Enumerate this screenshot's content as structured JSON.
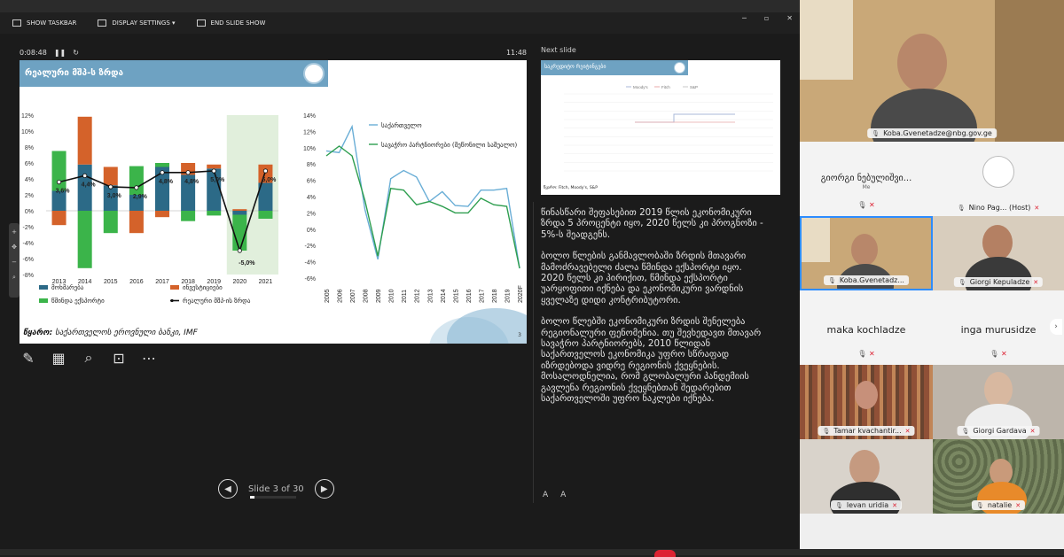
{
  "toolbar": {
    "show_taskbar": "SHOW TASKBAR",
    "display_settings": "DISPLAY SETTINGS ▾",
    "end_slide_show": "END SLIDE SHOW"
  },
  "timer": {
    "elapsed": "0:08:48",
    "clock": "11:48"
  },
  "next_slide_label": "Next slide",
  "slide": {
    "title": "რეალური მშპ-ს ზრდა",
    "source_label": "წყარო:",
    "source_text": " საქართველოს ეროვნული ბანკი, IMF",
    "page": "3"
  },
  "navigation": {
    "slide_counter": "Slide 3 of 30",
    "progress": 0.1
  },
  "next_slide": {
    "title": "საკრედიტო რეიტინგები",
    "legend": [
      "Moody's",
      "Fitch",
      "S&P"
    ],
    "source": "წყარო: Fitch, Moody's, S&P"
  },
  "notes": [
    "წინასწარი შეფასებით 2019 წლის ეკონომიკური ზრდა 5 პროცენტი იყო, 2020 წელს კი პროგნოზი - 5%-ს შეადგენს.",
    "ბოლო წლების განმავლობაში ზრდის მთავარი მამოძრავებელი ძალა წმინდა ექსპორტი იყო. 2020 წელს კი პირიქით, წმინდა ექსპორტი უარყოფითი იქნება და ეკონომიკური ვარდნის ყველაზე დიდი კონტრიბუტორი.",
    "ბოლო წლებში ეკონომიკური ზრდის შენელება რეგიონალური ფენომენია. თუ შევხედავთ მთავარ სავაჭრო პარტნიორებს, 2010 წლიდან საქართველოს ეკონომიკა უფრო სწრაფად იზრდებოდა ვიდრე რეგიონის ქვეყნების. მოსალოდნელია, რომ გლობალური პანდემიის გავლენა რეგიონის ქვეყნებთან შედარებით საქართველოში უფრო ნაკლები იქნება."
  ],
  "font_buttons": [
    "A",
    "A"
  ],
  "participants": [
    {
      "name": "Koba.Gvenetadze@nbg.gov.ge",
      "muted": false
    },
    {
      "name": "გიორგი ნებულიშვი...",
      "sub": "Me",
      "muted": true
    },
    {
      "name": "Nino Pag... (Host)",
      "muted": true
    },
    {
      "name": "Koba.Gvenetadz...",
      "muted": false
    },
    {
      "name": "Giorgi Kepuladze",
      "muted": true
    },
    {
      "name": "maka kochladze",
      "muted": true
    },
    {
      "name": "inga murusidze",
      "muted": true
    },
    {
      "name": "Tamar kvachantir...",
      "muted": true
    },
    {
      "name": "Giorgi Gardava",
      "muted": true
    },
    {
      "name": "levan uridia",
      "muted": true
    },
    {
      "name": "natalie",
      "muted": true
    }
  ],
  "chart_data": [
    {
      "type": "bar",
      "categories": [
        "2013",
        "2014",
        "2015",
        "2016",
        "2017",
        "2018",
        "2019",
        "2020",
        "2021"
      ],
      "series": [
        {
          "name": "მოხმარება",
          "color": "#2c6a87",
          "values": [
            2.5,
            5.8,
            3.2,
            2.0,
            5.5,
            4.5,
            5.3,
            -0.5,
            3.5
          ]
        },
        {
          "name": "ინვესტიციები",
          "color": "#d4622a",
          "values": [
            -1.8,
            6.0,
            2.3,
            -2.8,
            -0.8,
            1.5,
            0.5,
            0.2,
            2.3
          ]
        },
        {
          "name": "წმინდა ექსპორტი",
          "color": "#3bb44a",
          "values": [
            5.0,
            -7.2,
            -2.8,
            3.6,
            0.5,
            -1.3,
            -0.6,
            -4.5,
            -1.0
          ]
        }
      ],
      "line": {
        "name": "რეალური მშპ-ის ზრდა",
        "values": [
          3.6,
          4.4,
          3.0,
          2.9,
          4.8,
          4.8,
          5.0,
          -5.0,
          5.0
        ]
      },
      "data_labels": [
        "3,6%",
        "4,4%",
        "3,0%",
        "2,9%",
        "4,8%",
        "4,8%",
        "5,0%",
        "-5,0%",
        "5,0%"
      ],
      "y_ticks": [
        "12%",
        "10%",
        "8%",
        "6%",
        "4%",
        "2%",
        "0%",
        "-2%",
        "-4%",
        "-6%",
        "-8%"
      ],
      "ylim": [
        -8,
        12
      ],
      "legend_position": "bottom"
    },
    {
      "type": "line",
      "x": [
        "2005",
        "2006",
        "2007",
        "2008",
        "2009",
        "2010",
        "2011",
        "2012",
        "2013",
        "2014",
        "2015",
        "2016",
        "2017",
        "2018",
        "2019",
        "2020F"
      ],
      "series": [
        {
          "name": "საქართველო",
          "color": "#6aaed6",
          "values": [
            9.6,
            9.4,
            12.6,
            2.4,
            -3.7,
            6.2,
            7.2,
            6.4,
            3.4,
            4.6,
            2.9,
            2.8,
            4.8,
            4.8,
            5.0,
            -4.8
          ]
        },
        {
          "name": "სავაჭრო პარტნიორები (შეწონილი საშუალო)",
          "color": "#2e9e4f",
          "values": [
            9.0,
            10.2,
            9.0,
            3.5,
            -3.3,
            5.0,
            4.8,
            3.0,
            3.4,
            2.8,
            2.0,
            2.0,
            3.8,
            3.0,
            2.8,
            -4.8
          ]
        }
      ],
      "y_ticks": [
        "14%",
        "12%",
        "10%",
        "8%",
        "6%",
        "4%",
        "2%",
        "0%",
        "-2%",
        "-4%",
        "-6%"
      ],
      "ylim": [
        -6,
        14
      ],
      "legend_position": "top-right"
    }
  ]
}
